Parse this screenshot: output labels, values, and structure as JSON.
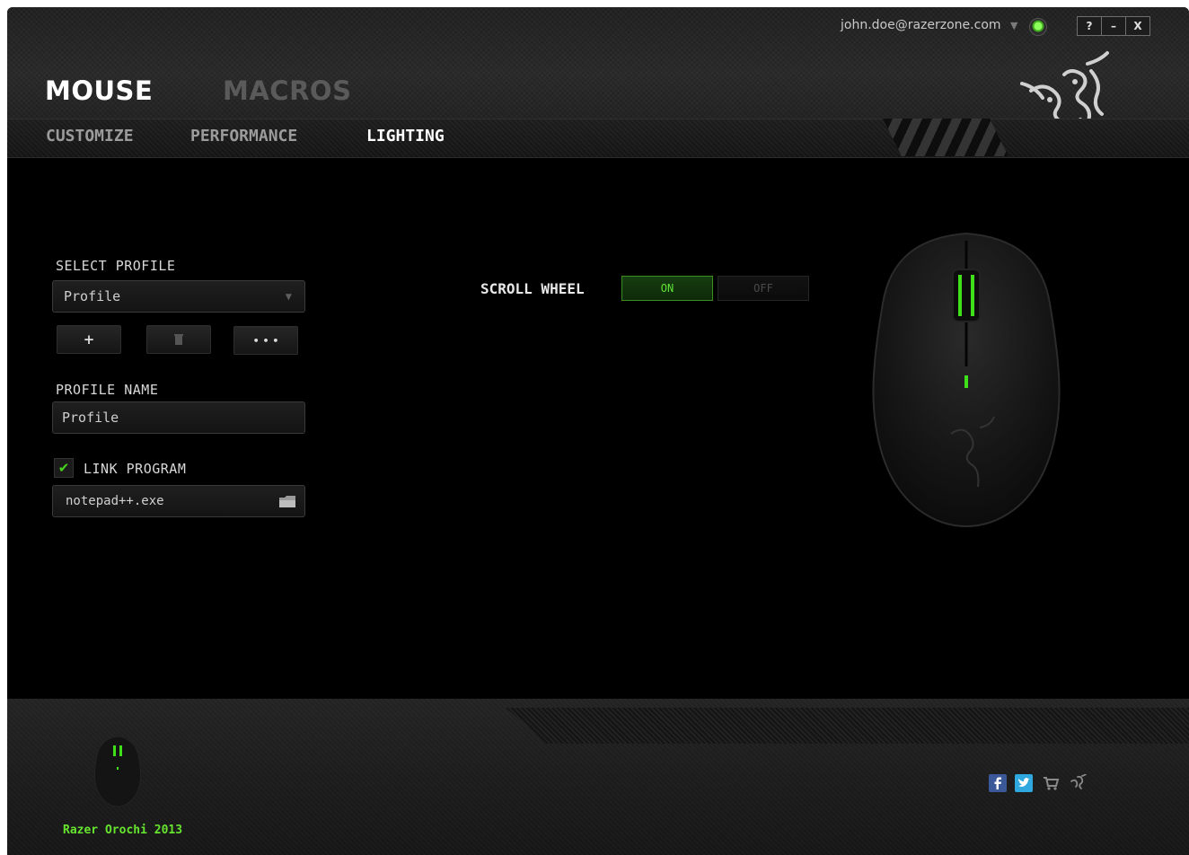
{
  "account": {
    "email": "john.doe@razerzone.com",
    "caret": "▼",
    "status_color": "#4ad31d"
  },
  "window_controls": {
    "help": "?",
    "minimize": "–",
    "close": "X"
  },
  "main_tabs": [
    {
      "label": "MOUSE",
      "active": true
    },
    {
      "label": "MACROS",
      "active": false
    }
  ],
  "sub_tabs": [
    {
      "label": "CUSTOMIZE",
      "active": false
    },
    {
      "label": "PERFORMANCE",
      "active": false
    },
    {
      "label": "LIGHTING",
      "active": true
    }
  ],
  "profile": {
    "select_label": "SELECT PROFILE",
    "selected": "Profile",
    "dropdown_caret": "▼",
    "buttons": {
      "add": "+",
      "delete_icon": "trash-icon",
      "more": "• • •"
    },
    "name_label": "PROFILE NAME",
    "name_value": "Profile",
    "link_program_label": "LINK PROGRAM",
    "link_program_checked": true,
    "checkmark": "✔",
    "program_value": "notepad++.exe"
  },
  "lighting": {
    "scroll_wheel_label": "SCROLL WHEEL",
    "on_label": "ON",
    "off_label": "OFF",
    "state": "on"
  },
  "footer": {
    "device_name": "Razer Orochi 2013",
    "social_icons": [
      "facebook-icon",
      "twitter-icon",
      "store-cart-icon",
      "razer-icon"
    ]
  },
  "colors": {
    "accent": "#4ad31d",
    "background": "#000000",
    "text_light": "#d8d8d8"
  }
}
